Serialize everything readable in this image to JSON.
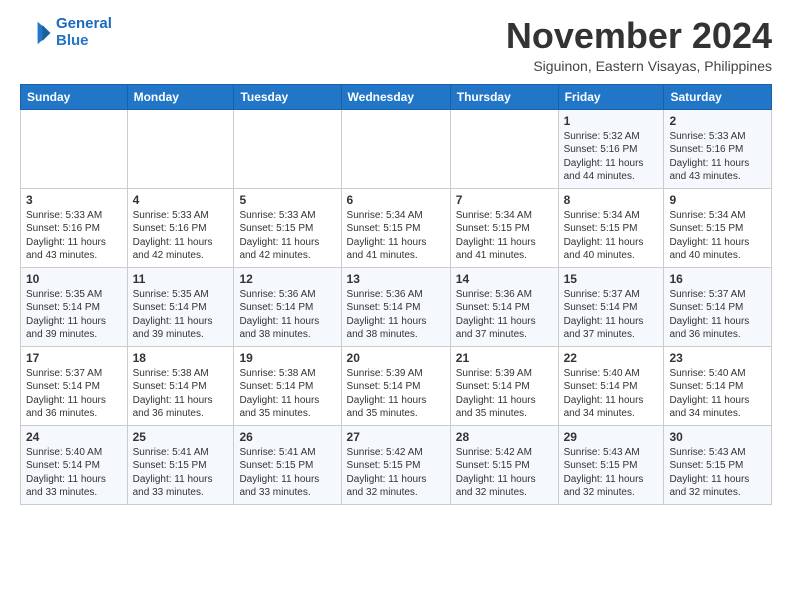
{
  "header": {
    "logo_line1": "General",
    "logo_line2": "Blue",
    "month_title": "November 2024",
    "location": "Siguinon, Eastern Visayas, Philippines"
  },
  "weekdays": [
    "Sunday",
    "Monday",
    "Tuesday",
    "Wednesday",
    "Thursday",
    "Friday",
    "Saturday"
  ],
  "weeks": [
    [
      {
        "day": "",
        "info": ""
      },
      {
        "day": "",
        "info": ""
      },
      {
        "day": "",
        "info": ""
      },
      {
        "day": "",
        "info": ""
      },
      {
        "day": "",
        "info": ""
      },
      {
        "day": "1",
        "info": "Sunrise: 5:32 AM\nSunset: 5:16 PM\nDaylight: 11 hours and 44 minutes."
      },
      {
        "day": "2",
        "info": "Sunrise: 5:33 AM\nSunset: 5:16 PM\nDaylight: 11 hours and 43 minutes."
      }
    ],
    [
      {
        "day": "3",
        "info": "Sunrise: 5:33 AM\nSunset: 5:16 PM\nDaylight: 11 hours and 43 minutes."
      },
      {
        "day": "4",
        "info": "Sunrise: 5:33 AM\nSunset: 5:16 PM\nDaylight: 11 hours and 42 minutes."
      },
      {
        "day": "5",
        "info": "Sunrise: 5:33 AM\nSunset: 5:15 PM\nDaylight: 11 hours and 42 minutes."
      },
      {
        "day": "6",
        "info": "Sunrise: 5:34 AM\nSunset: 5:15 PM\nDaylight: 11 hours and 41 minutes."
      },
      {
        "day": "7",
        "info": "Sunrise: 5:34 AM\nSunset: 5:15 PM\nDaylight: 11 hours and 41 minutes."
      },
      {
        "day": "8",
        "info": "Sunrise: 5:34 AM\nSunset: 5:15 PM\nDaylight: 11 hours and 40 minutes."
      },
      {
        "day": "9",
        "info": "Sunrise: 5:34 AM\nSunset: 5:15 PM\nDaylight: 11 hours and 40 minutes."
      }
    ],
    [
      {
        "day": "10",
        "info": "Sunrise: 5:35 AM\nSunset: 5:14 PM\nDaylight: 11 hours and 39 minutes."
      },
      {
        "day": "11",
        "info": "Sunrise: 5:35 AM\nSunset: 5:14 PM\nDaylight: 11 hours and 39 minutes."
      },
      {
        "day": "12",
        "info": "Sunrise: 5:36 AM\nSunset: 5:14 PM\nDaylight: 11 hours and 38 minutes."
      },
      {
        "day": "13",
        "info": "Sunrise: 5:36 AM\nSunset: 5:14 PM\nDaylight: 11 hours and 38 minutes."
      },
      {
        "day": "14",
        "info": "Sunrise: 5:36 AM\nSunset: 5:14 PM\nDaylight: 11 hours and 37 minutes."
      },
      {
        "day": "15",
        "info": "Sunrise: 5:37 AM\nSunset: 5:14 PM\nDaylight: 11 hours and 37 minutes."
      },
      {
        "day": "16",
        "info": "Sunrise: 5:37 AM\nSunset: 5:14 PM\nDaylight: 11 hours and 36 minutes."
      }
    ],
    [
      {
        "day": "17",
        "info": "Sunrise: 5:37 AM\nSunset: 5:14 PM\nDaylight: 11 hours and 36 minutes."
      },
      {
        "day": "18",
        "info": "Sunrise: 5:38 AM\nSunset: 5:14 PM\nDaylight: 11 hours and 36 minutes."
      },
      {
        "day": "19",
        "info": "Sunrise: 5:38 AM\nSunset: 5:14 PM\nDaylight: 11 hours and 35 minutes."
      },
      {
        "day": "20",
        "info": "Sunrise: 5:39 AM\nSunset: 5:14 PM\nDaylight: 11 hours and 35 minutes."
      },
      {
        "day": "21",
        "info": "Sunrise: 5:39 AM\nSunset: 5:14 PM\nDaylight: 11 hours and 35 minutes."
      },
      {
        "day": "22",
        "info": "Sunrise: 5:40 AM\nSunset: 5:14 PM\nDaylight: 11 hours and 34 minutes."
      },
      {
        "day": "23",
        "info": "Sunrise: 5:40 AM\nSunset: 5:14 PM\nDaylight: 11 hours and 34 minutes."
      }
    ],
    [
      {
        "day": "24",
        "info": "Sunrise: 5:40 AM\nSunset: 5:14 PM\nDaylight: 11 hours and 33 minutes."
      },
      {
        "day": "25",
        "info": "Sunrise: 5:41 AM\nSunset: 5:15 PM\nDaylight: 11 hours and 33 minutes."
      },
      {
        "day": "26",
        "info": "Sunrise: 5:41 AM\nSunset: 5:15 PM\nDaylight: 11 hours and 33 minutes."
      },
      {
        "day": "27",
        "info": "Sunrise: 5:42 AM\nSunset: 5:15 PM\nDaylight: 11 hours and 32 minutes."
      },
      {
        "day": "28",
        "info": "Sunrise: 5:42 AM\nSunset: 5:15 PM\nDaylight: 11 hours and 32 minutes."
      },
      {
        "day": "29",
        "info": "Sunrise: 5:43 AM\nSunset: 5:15 PM\nDaylight: 11 hours and 32 minutes."
      },
      {
        "day": "30",
        "info": "Sunrise: 5:43 AM\nSunset: 5:15 PM\nDaylight: 11 hours and 32 minutes."
      }
    ]
  ]
}
